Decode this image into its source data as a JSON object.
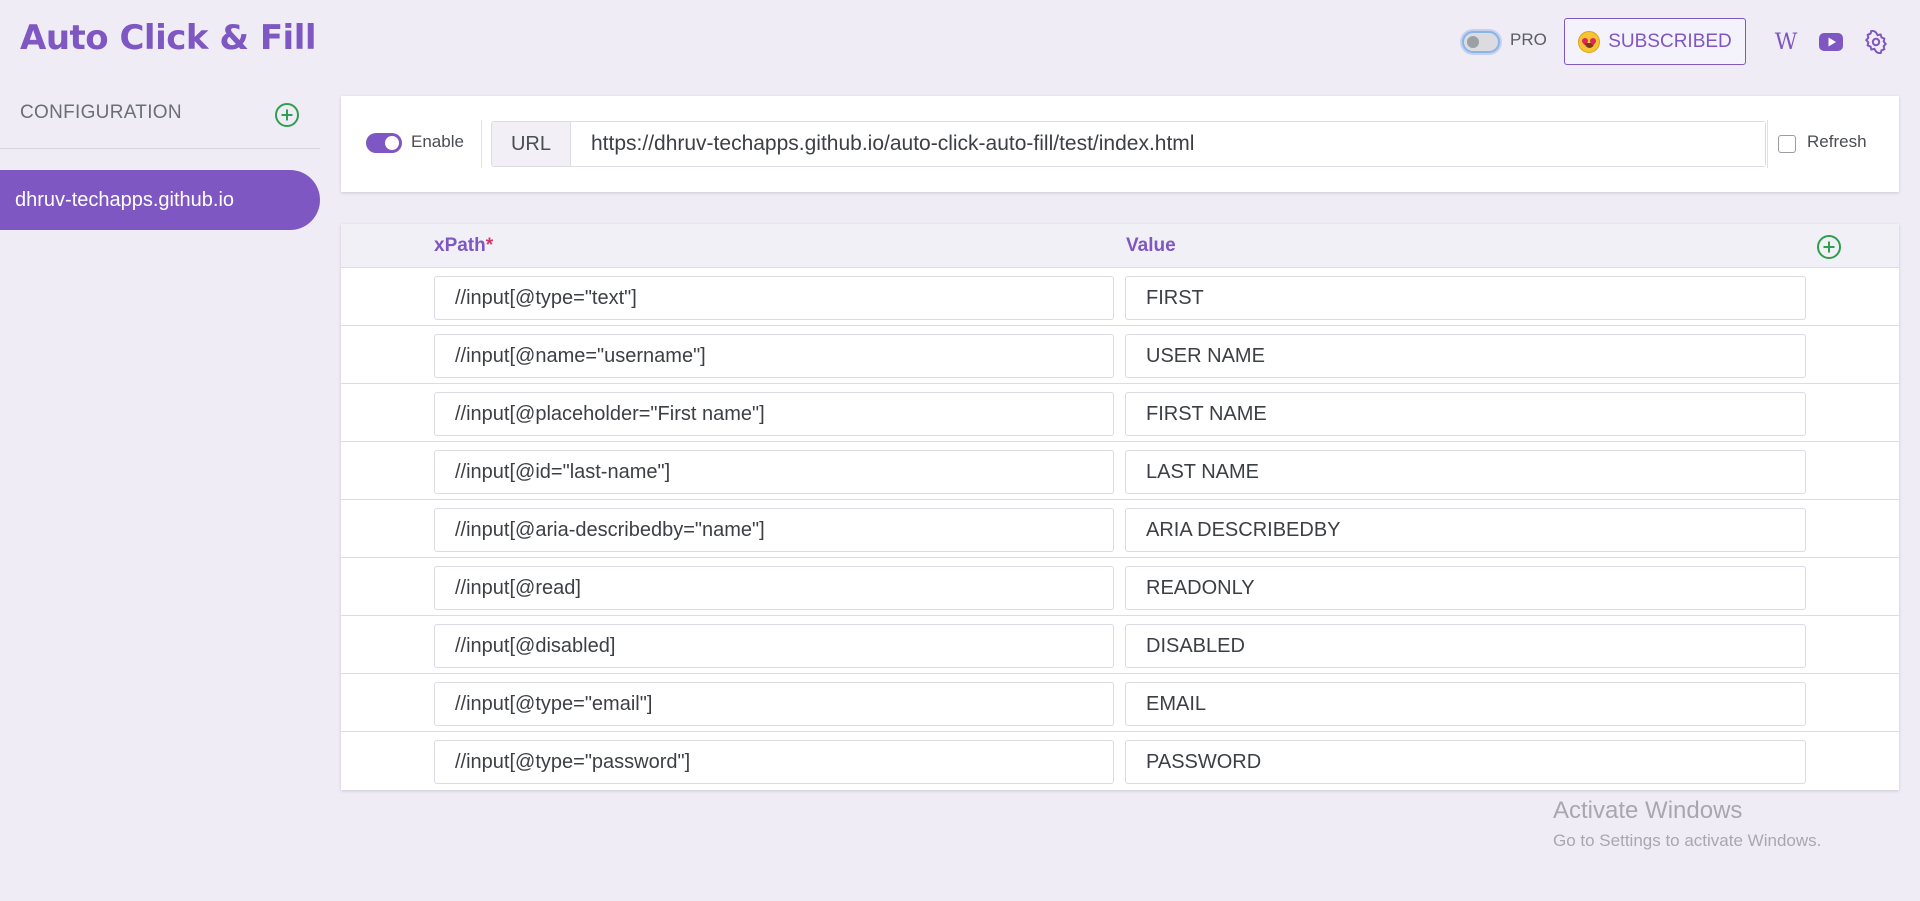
{
  "app": {
    "title": "Auto Click & Fill"
  },
  "header": {
    "pro_label": "PRO",
    "pro_enabled": false,
    "subscribed_label": "SUBSCRIBED",
    "wiki_glyph": "W",
    "icons": [
      "emoji-star-struck-icon",
      "wikipedia-icon",
      "youtube-icon",
      "gear-icon"
    ]
  },
  "sidebar": {
    "title": "CONFIGURATION",
    "items": [
      {
        "label": "dhruv-techapps.github.io",
        "active": true
      }
    ]
  },
  "config": {
    "enable_label": "Enable",
    "enabled": true,
    "url_label": "URL",
    "url_value": "https://dhruv-techapps.github.io/auto-click-auto-fill/test/index.html",
    "refresh_label": "Refresh",
    "refresh_checked": false
  },
  "table": {
    "headers": {
      "xpath": "xPath",
      "required_mark": "*",
      "value": "Value"
    },
    "rows": [
      {
        "xpath": "//input[@type=\"text\"]",
        "value": "FIRST"
      },
      {
        "xpath": "//input[@name=\"username\"]",
        "value": "USER NAME"
      },
      {
        "xpath": "//input[@placeholder=\"First name\"]",
        "value": "FIRST NAME"
      },
      {
        "xpath": "//input[@id=\"last-name\"]",
        "value": "LAST NAME"
      },
      {
        "xpath": "//input[@aria-describedby=\"name\"]",
        "value": "ARIA DESCRIBEDBY"
      },
      {
        "xpath": "//input[@read]",
        "value": "READONLY"
      },
      {
        "xpath": "//input[@disabled]",
        "value": "DISABLED"
      },
      {
        "xpath": "//input[@type=\"email\"]",
        "value": "EMAIL"
      },
      {
        "xpath": "//input[@type=\"password\"]",
        "value": "PASSWORD"
      }
    ]
  },
  "watermark": {
    "title": "Activate Windows",
    "subtitle": "Go to Settings to activate Windows."
  },
  "colors": {
    "accent": "#7e57c2",
    "add_green": "#2e9e4f",
    "background": "#efecf6",
    "required": "#d6336c"
  }
}
